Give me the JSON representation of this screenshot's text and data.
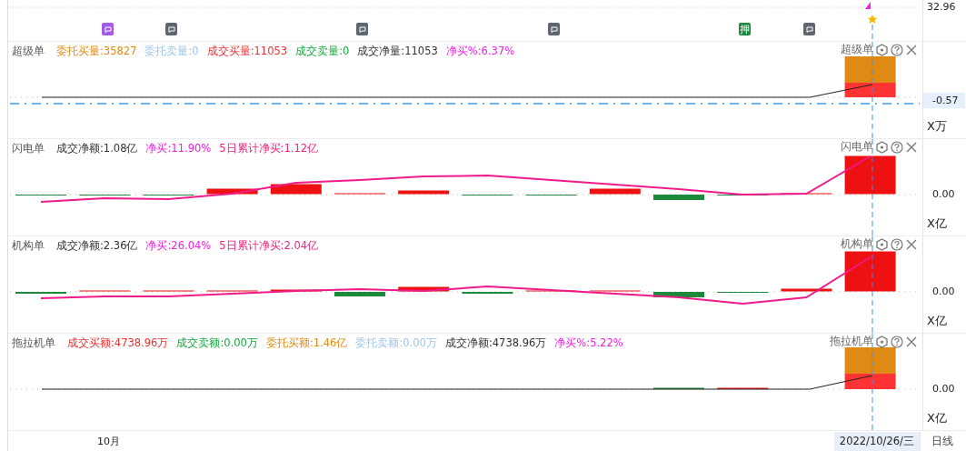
{
  "top_axis": {
    "price": "32.96"
  },
  "markers": [
    {
      "kind": "icon",
      "color": "#a25be8"
    },
    {
      "kind": "icon",
      "color": "#5f6670"
    },
    {
      "kind": "icon",
      "color": "#5f6670"
    },
    {
      "kind": "icon",
      "color": "#5f6670"
    },
    {
      "kind": "text",
      "label": "押",
      "color": "#1a8a3c"
    },
    {
      "kind": "icon",
      "color": "#5f6670"
    }
  ],
  "panels": [
    {
      "name": "超级单",
      "title": "超级单",
      "kind": "volume",
      "metrics": [
        {
          "text": "委托买量:35827",
          "color": "#e08a12"
        },
        {
          "text": "委托卖量:0",
          "color": "#9cc6ea"
        },
        {
          "text": "成交买量:11053",
          "color": "#f03030"
        },
        {
          "text": "成交卖量:0",
          "color": "#14a83c"
        },
        {
          "text": "成交净量:11053",
          "color": "#333333"
        },
        {
          "text": "净买%:6.37%",
          "color": "#f020e0"
        }
      ],
      "axis_value": "-0.57",
      "axis_highlighted": true,
      "unit": "X万"
    },
    {
      "name": "闪电单",
      "title": "闪电单",
      "kind": "flow",
      "metrics": [
        {
          "text": "成交净额:1.08亿",
          "color": "#333333"
        },
        {
          "text": "净买:11.90%",
          "color": "#f020e0"
        },
        {
          "text": "5日累计净买:1.12亿",
          "color": "#f0207e"
        }
      ],
      "axis_value": "0.00",
      "axis_highlighted": false,
      "unit": "X亿"
    },
    {
      "name": "机构单",
      "title": "机构单",
      "kind": "flow",
      "metrics": [
        {
          "text": "成交净额:2.36亿",
          "color": "#333333"
        },
        {
          "text": "净买:26.04%",
          "color": "#f020e0"
        },
        {
          "text": "5日累计净买:2.04亿",
          "color": "#f0207e"
        }
      ],
      "axis_value": "0.00",
      "axis_highlighted": false,
      "unit": "X亿"
    },
    {
      "name": "拖拉机单",
      "title": "拖拉机单",
      "kind": "volume",
      "metrics": [
        {
          "text": "成交买额:4738.96万",
          "color": "#f03030"
        },
        {
          "text": "成交卖额:0.00万",
          "color": "#14a83c"
        },
        {
          "text": "委托买额:1.46亿",
          "color": "#e08a12"
        },
        {
          "text": "委托卖额:0.00万",
          "color": "#9cc6ea"
        },
        {
          "text": "成交净额:4738.96万",
          "color": "#333333"
        },
        {
          "text": "净买%:5.22%",
          "color": "#f020e0"
        }
      ],
      "axis_value": "0.00",
      "axis_highlighted": false,
      "unit": "X亿"
    }
  ],
  "bottom_axis": {
    "month": "10月",
    "date": "2022/10/26/三",
    "period": "日线"
  }
}
